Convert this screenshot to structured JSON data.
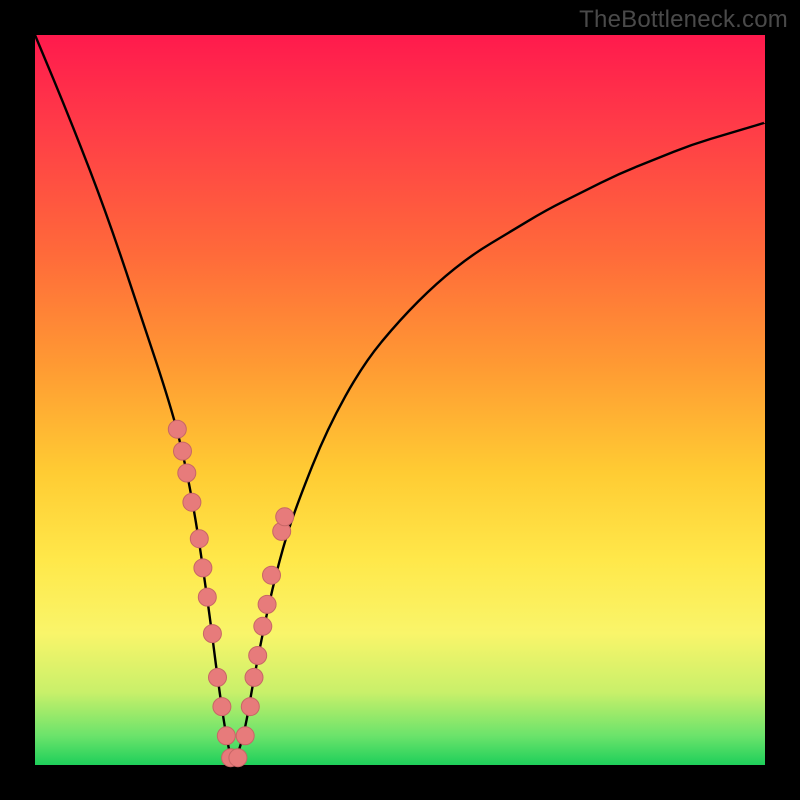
{
  "watermark": "TheBottleneck.com",
  "colors": {
    "background": "#000000",
    "curve": "#000000",
    "marker_fill": "#e77b7b",
    "marker_stroke": "#c76666"
  },
  "chart_data": {
    "type": "line",
    "title": "",
    "xlabel": "",
    "ylabel": "",
    "xlim": [
      0,
      100
    ],
    "ylim": [
      0,
      100
    ],
    "grid": false,
    "legend": false,
    "note": "Curve shows bottleneck % (0 at valley ≈ x=27). y-values are approximate heights read from the image (0=bottom, 100=top).",
    "series": [
      {
        "name": "bottleneck-curve",
        "x": [
          0,
          5,
          10,
          15,
          18,
          20,
          22,
          24,
          25,
          26,
          27,
          28,
          29,
          30,
          32,
          34,
          36,
          40,
          45,
          50,
          55,
          60,
          65,
          70,
          75,
          80,
          85,
          90,
          95,
          100
        ],
        "values": [
          100,
          88,
          75,
          60,
          51,
          44,
          34,
          20,
          12,
          5,
          0,
          2,
          6,
          12,
          22,
          30,
          36,
          46,
          55,
          61,
          66,
          70,
          73,
          76,
          78.5,
          81,
          83,
          85,
          86.5,
          88
        ]
      }
    ],
    "markers": {
      "name": "highlighted-points",
      "x": [
        19.5,
        20.2,
        20.8,
        21.5,
        22.5,
        23.0,
        23.6,
        24.3,
        25.0,
        25.6,
        26.2,
        26.8,
        27.8,
        28.8,
        29.5,
        30.0,
        30.5,
        31.2,
        31.8,
        32.4,
        33.8,
        34.2
      ],
      "y": [
        46,
        43,
        40,
        36,
        31,
        27,
        23,
        18,
        12,
        8,
        4,
        1,
        1,
        4,
        8,
        12,
        15,
        19,
        22,
        26,
        32,
        34
      ]
    }
  }
}
